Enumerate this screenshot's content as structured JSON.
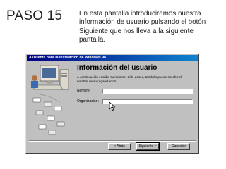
{
  "slide": {
    "title": "PASO 15",
    "description": "En esta pantalla introduciremos nuestra información de usuario pulsando el botón Siguiente que nos lleva a la siguiente pantalla."
  },
  "dialog": {
    "window_title": "Asistente para la instalación de Windows 98",
    "heading": "Información del usuario",
    "instructions": "A continuación escriba su nombre. Si lo desea, también puede escribir el nombre de su organización.",
    "fields": {
      "name_label": "Nombre:",
      "name_value": "",
      "organization_label": "Organización:",
      "organization_value": ""
    },
    "buttons": {
      "back": "< Atrás",
      "next": "Siguiente >",
      "cancel": "Cancelar"
    },
    "colors": {
      "titlebar": "#000080",
      "face": "#c0c0c0"
    }
  }
}
